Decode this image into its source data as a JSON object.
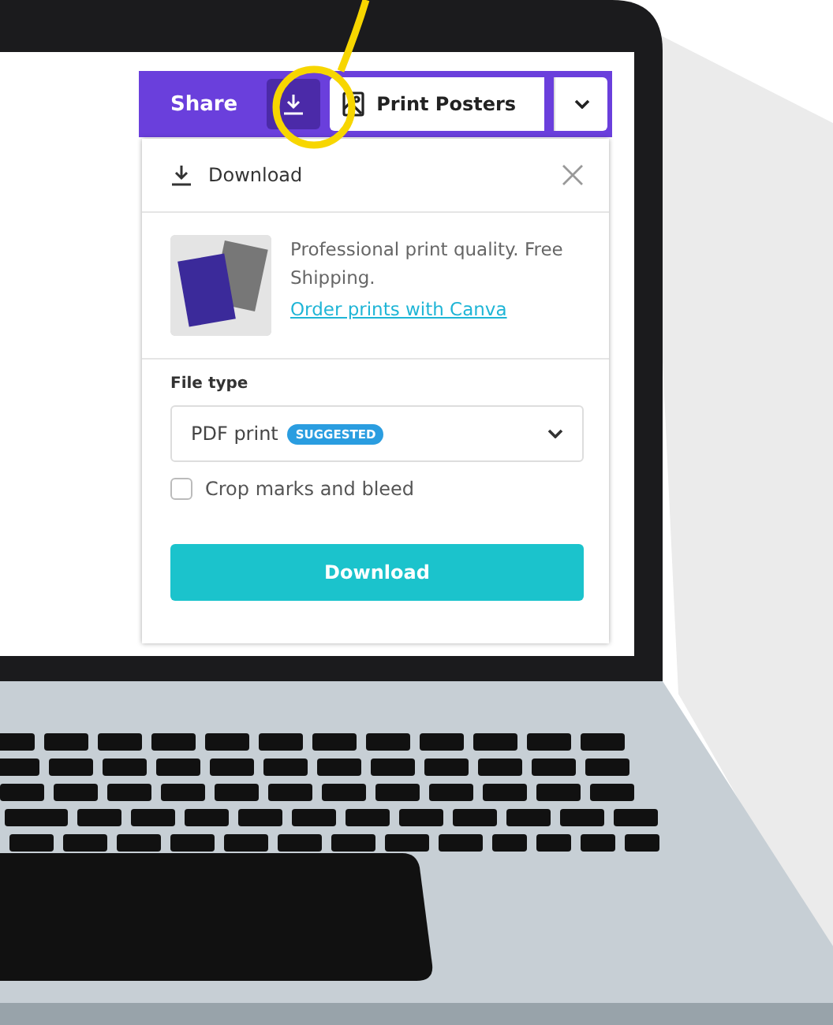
{
  "toolbar": {
    "share_label": "Share",
    "download_selected": true,
    "download_highlighted": true,
    "print_label": "Print Posters"
  },
  "panel": {
    "title": "Download",
    "promo_text": "Professional print quality. Free Shipping.",
    "promo_link": "Order prints with Canva",
    "file_type_label": "File type",
    "file_type_value": "PDF print",
    "badge": "SUGGESTED",
    "crop_marks": {
      "label": "Crop marks and bleed",
      "checked": false
    },
    "button": "Download"
  }
}
